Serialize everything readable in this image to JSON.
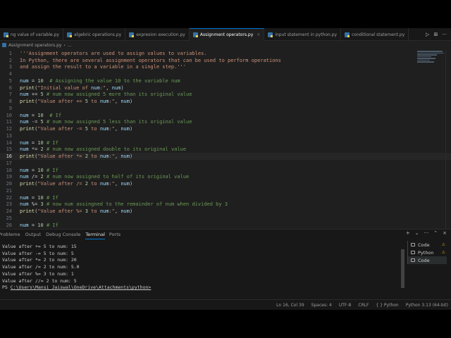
{
  "tabs": [
    {
      "label": "ng value of variable.py",
      "active": false
    },
    {
      "label": "algebric operations.py",
      "active": false
    },
    {
      "label": "expresion execution.py",
      "active": false
    },
    {
      "label": "Assignment operators.py",
      "active": true
    },
    {
      "label": "input statement in python.py",
      "active": false
    },
    {
      "label": "conditional statement.py",
      "active": false
    }
  ],
  "tab_close": "×",
  "tab_actions": [
    "▷",
    "⊞",
    "···"
  ],
  "breadcrumb": {
    "file": "Assignment operators.py",
    "rest": "..."
  },
  "editor": {
    "current_line": 16,
    "lines": [
      {
        "n": "1",
        "text": "'''Assignment operators are used to assign values to variables."
      },
      {
        "n": "2",
        "text": "In Python, there are several assignment operators that can be used to perform operations"
      },
      {
        "n": "3",
        "text": "and assign the result to a variable in a single step.'''"
      },
      {
        "n": "4",
        "text": ""
      },
      {
        "n": "5",
        "text": "num = 10  # Assigning the value 10 to the variable num"
      },
      {
        "n": "6",
        "text": "print(\"Initial value of num:\", num)"
      },
      {
        "n": "7",
        "text": "num += 5 # num now assigned 5 more than its original value"
      },
      {
        "n": "8",
        "text": "print(\"Value after += 5 to num:\", num)"
      },
      {
        "n": "9",
        "text": ""
      },
      {
        "n": "10",
        "text": "num = 10  # If"
      },
      {
        "n": "11",
        "text": "num -= 5 # num now assigned 5 less than its original value"
      },
      {
        "n": "12",
        "text": "print(\"Value after -= 5 to num:\", num)"
      },
      {
        "n": "13",
        "text": ""
      },
      {
        "n": "14",
        "text": "num = 10 # If"
      },
      {
        "n": "15",
        "text": "num *= 2 # num now assigned double to its original value"
      },
      {
        "n": "16",
        "text": "print(\"Value after *= 2 to num:\", num)"
      },
      {
        "n": "17",
        "text": ""
      },
      {
        "n": "18",
        "text": "num = 10 # If"
      },
      {
        "n": "19",
        "text": "num /= 2 # num now assigned to half of its original value"
      },
      {
        "n": "20",
        "text": "print(\"Value after /= 2 to num:\", num)"
      },
      {
        "n": "21",
        "text": ""
      },
      {
        "n": "22",
        "text": "num = 10 # If"
      },
      {
        "n": "23",
        "text": "num %= 3 # now num assingned to the remainder of num when divided by 3"
      },
      {
        "n": "24",
        "text": "print(\"Value after %= 3 to num:\", num)"
      },
      {
        "n": "25",
        "text": ""
      },
      {
        "n": "26",
        "text": "num = 10 # If"
      }
    ]
  },
  "panel": {
    "tabs": [
      "Probleme",
      "Output",
      "Debug Console",
      "Terminal",
      "Ports"
    ],
    "active_tab": "Terminal",
    "actions": [
      "+",
      "⌄",
      "···",
      "⌃",
      "×"
    ],
    "terminal_lines": [
      "Value after += 5 to num: 15",
      "Value after -= 5 to num: 5",
      "Value after *= 2 to num: 20",
      "Value after /= 2 to num: 5.0",
      "Value after %= 3 to num: 1",
      "Value after //= 2 to num: 5"
    ],
    "prompt_prefix": "PS ",
    "prompt_path": "C:\\Users\\Mansi Jaiswal\\OneDrive\\Attachments\\python>",
    "terminal_list": [
      {
        "label": "Code",
        "warn": true,
        "selected": false
      },
      {
        "label": "Python",
        "warn": true,
        "selected": false
      },
      {
        "label": "Code",
        "warn": false,
        "selected": true
      }
    ],
    "warn_icon": "⚠"
  },
  "status": {
    "position": "Ln 16, Col 39",
    "spaces": "Spaces: 4",
    "encoding": "UTF-8",
    "eol": "CRLF",
    "language": "{ } Python",
    "interpreter": "Python 3.13 (64-bit)"
  }
}
